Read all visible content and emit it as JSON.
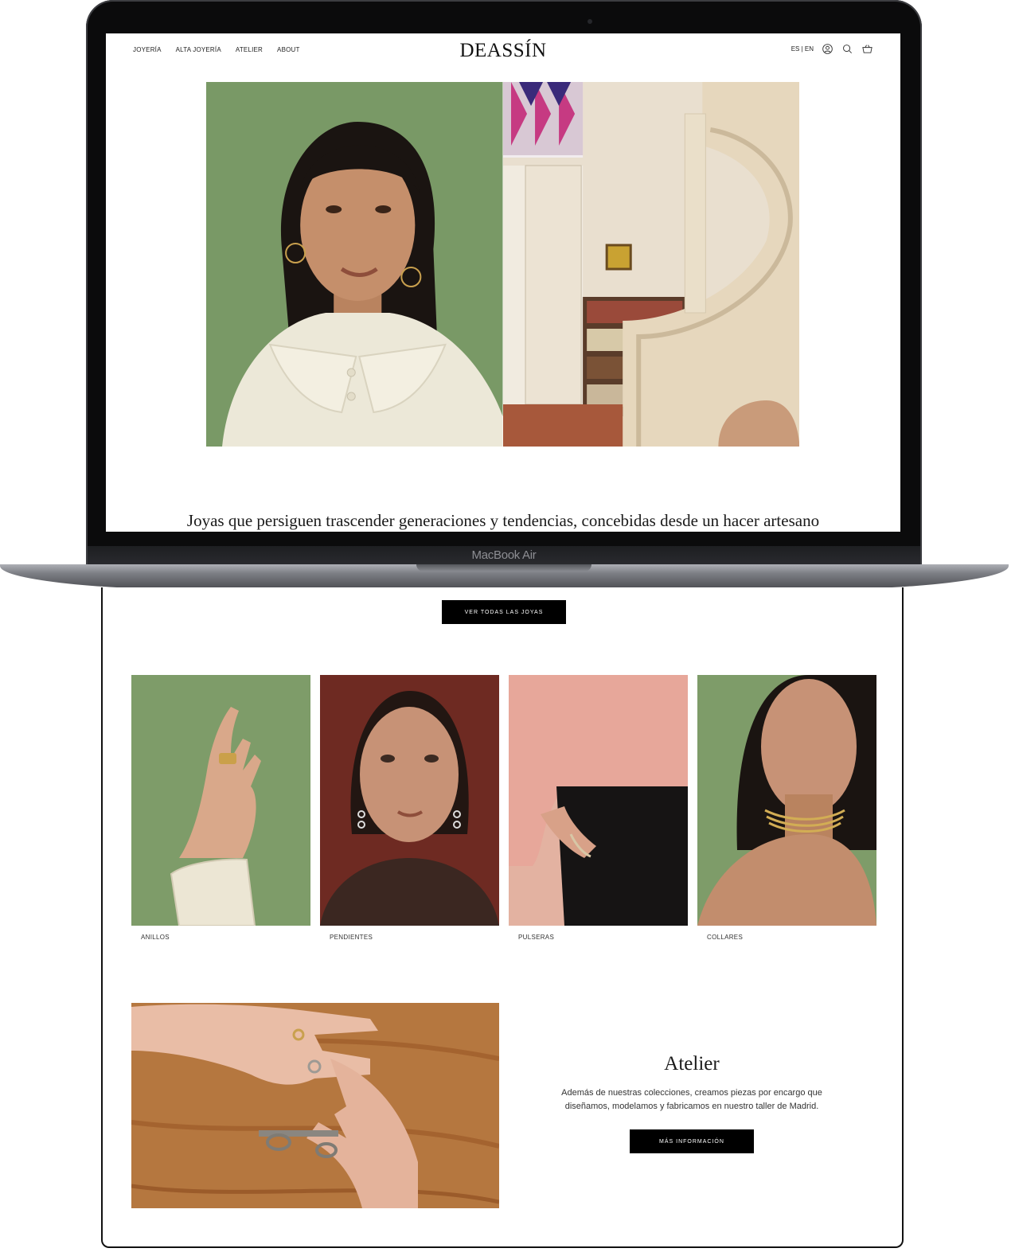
{
  "device": {
    "label": "MacBook Air"
  },
  "header": {
    "nav": [
      "JOYERÍA",
      "ALTA JOYERÍA",
      "ATELIER",
      "ABOUT"
    ],
    "logo": "DEASSÍN",
    "language": "ES | EN",
    "icons": [
      "account-icon",
      "search-icon",
      "basket-icon"
    ]
  },
  "hero": {
    "tagline": "Joyas que persiguen trascender generaciones y tendencias, concebidas desde un hacer artesano y una mirada contemporánea en busca de calidad."
  },
  "cta": {
    "all_jewels": "VER TODAS LAS JOYAS"
  },
  "categories": [
    {
      "label": "ANILLOS"
    },
    {
      "label": "PENDIENTES"
    },
    {
      "label": "PULSERAS"
    },
    {
      "label": "COLLARES"
    }
  ],
  "atelier": {
    "title": "Atelier",
    "description": "Además de nuestras colecciones, creamos piezas por encargo que diseñamos, modelamos y fabricamos en nuestro taller de Madrid.",
    "button": "MÁS INFORMACIÓN"
  },
  "colors": {
    "background": "#ffffff",
    "button": "#000000",
    "hero_green": "#7e9f6b",
    "laptop": "#0b0b0c"
  }
}
